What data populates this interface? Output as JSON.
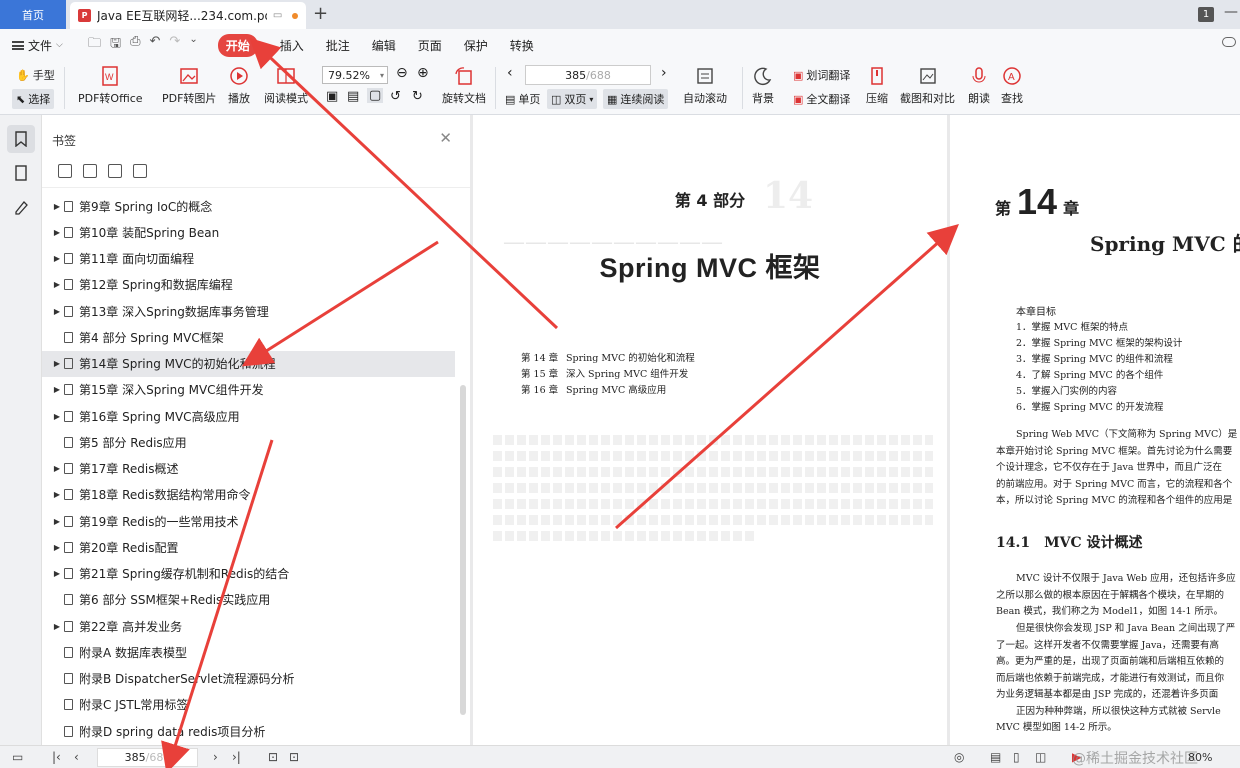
{
  "tabs": {
    "home": "首页",
    "doc_title": "Java EE互联网轻...234.com.pdf",
    "badge": "1"
  },
  "menubar": {
    "file": "文件",
    "tabs": [
      "开始",
      "插入",
      "批注",
      "编辑",
      "页面",
      "保护",
      "转换"
    ],
    "active_tab": "开始"
  },
  "ribbon": {
    "hand": "手型",
    "select": "选择",
    "pdf_to_office": "PDF转Office",
    "pdf_to_image": "PDF转图片",
    "play": "播放",
    "read_mode": "阅读模式",
    "zoom": "79.52%",
    "rotate": "旋转文档",
    "page_current": "385",
    "page_total": "/688",
    "single": "单页",
    "double": "双页",
    "continuous": "连续阅读",
    "auto_scroll": "自动滚动",
    "background": "背景",
    "word_translate": "划词翻译",
    "full_translate": "全文翻译",
    "compress": "压缩",
    "screenshot_compare": "截图和对比",
    "read_aloud": "朗读",
    "find": "查找"
  },
  "bookmarks": {
    "title": "书签",
    "items": [
      {
        "label": "第9章 Spring IoC的概念",
        "expandable": true
      },
      {
        "label": "第10章 装配Spring Bean",
        "expandable": true
      },
      {
        "label": "第11章 面向切面编程",
        "expandable": true
      },
      {
        "label": "第12章 Spring和数据库编程",
        "expandable": true
      },
      {
        "label": "第13章 深入Spring数据库事务管理",
        "expandable": true
      },
      {
        "label": "第4 部分 Spring MVC框架",
        "expandable": false
      },
      {
        "label": "第14章 Spring MVC的初始化和流程",
        "expandable": true,
        "selected": true
      },
      {
        "label": "第15章 深入Spring MVC组件开发",
        "expandable": true
      },
      {
        "label": "第16章 Spring MVC高级应用",
        "expandable": true
      },
      {
        "label": "第5 部分 Redis应用",
        "expandable": false
      },
      {
        "label": "第17章 Redis概述",
        "expandable": true
      },
      {
        "label": "第18章 Redis数据结构常用命令",
        "expandable": true
      },
      {
        "label": "第19章 Redis的一些常用技术",
        "expandable": true
      },
      {
        "label": "第20章 Redis配置",
        "expandable": true
      },
      {
        "label": "第21章 Spring缓存机制和Redis的结合",
        "expandable": true
      },
      {
        "label": "第6 部分 SSM框架+Redis实践应用",
        "expandable": false
      },
      {
        "label": "第22章 高并发业务",
        "expandable": true
      },
      {
        "label": "附录A 数据库表模型",
        "expandable": false
      },
      {
        "label": "附录B DispatcherServlet流程源码分析",
        "expandable": false
      },
      {
        "label": "附录C JSTL常用标签",
        "expandable": false
      },
      {
        "label": "附录D spring data redis项目分析",
        "expandable": false
      }
    ]
  },
  "page_left": {
    "part": "第 4 部分",
    "title": "Spring MVC 框架",
    "toc": [
      {
        "ch": "第 14 章",
        "name": "Spring MVC 的初始化和流程"
      },
      {
        "ch": "第 15 章",
        "name": "深入 Spring MVC 组件开发"
      },
      {
        "ch": "第 16 章",
        "name": "Spring MVC 高级应用"
      }
    ]
  },
  "page_right": {
    "chap_prefix": "第",
    "chap_num": "14",
    "chap_suffix": "章",
    "title": "Spring MVC 的",
    "goal_head": "本章目标",
    "goals": [
      "1．掌握 MVC 框架的特点",
      "2．掌握 Spring MVC 框架的架构设计",
      "3．掌握 Spring MVC 的组件和流程",
      "4．了解 Spring MVC 的各个组件",
      "5．掌握入门实例的内容",
      "6．掌握 Spring MVC 的开发流程"
    ],
    "intro": [
      "Spring Web MVC（下文简称为 Spring MVC）是 S",
      "本章开始讨论 Spring MVC 框架。首先讨论为什么需要",
      "个设计理念，它不仅存在于 Java 世界中，而且广泛在",
      "的前端应用。对于 Spring MVC 而言，它的流程和各个",
      "本，所以讨论 Spring MVC 的流程和各个组件的应用是"
    ],
    "section": "14.1　MVC 设计概述",
    "para1": [
      "MVC 设计不仅限于 Java Web 应用，还包括许多应",
      "之所以那么做的根本原因在于解耦各个模块，在早期的",
      "Bean 模式，我们称之为 Model1，如图 14-1 所示。"
    ],
    "para2": [
      "但是很快你会发现 JSP 和 Java Bean 之间出现了严",
      "了一起。这样开发者不仅需要掌握 Java，还需要有高",
      "高。更为严重的是，出现了页面前端和后端相互依赖的",
      "而后端也依赖于前端完成，才能进行有效测试，而且你",
      "为业务逻辑基本都是由 JSP 完成的，还混着许多页面",
      "正因为种种弊端，所以很快这种方式就被 Servle",
      "MVC 模型如图 14-2 所示。"
    ]
  },
  "statusbar": {
    "page_current": "385",
    "page_total": "/688",
    "zoom": "80%",
    "watermark": "@稀土掘金技术社区"
  },
  "colors": {
    "accent": "#e54540",
    "home_tab": "#3b76d8",
    "arrow": "#e8403a"
  }
}
